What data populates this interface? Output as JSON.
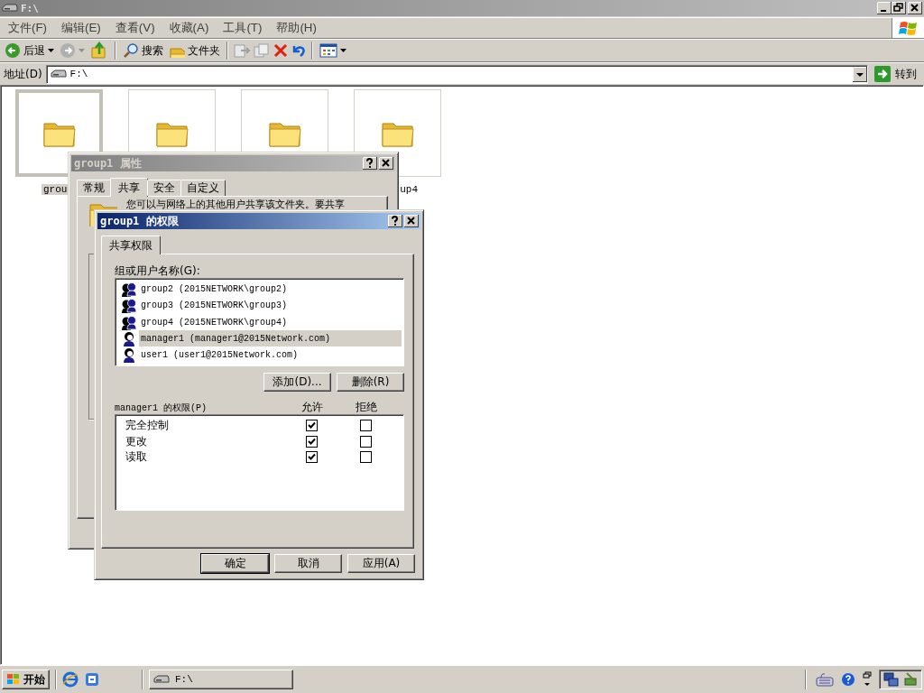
{
  "explorer": {
    "title": "F:\\",
    "menu": [
      "文件(F)",
      "编辑(E)",
      "查看(V)",
      "收藏(A)",
      "工具(T)",
      "帮助(H)"
    ],
    "toolbar": [
      {
        "kind": "back",
        "label": "后退"
      },
      {
        "kind": "forward"
      },
      {
        "kind": "up"
      },
      {
        "kind": "search",
        "label": "搜索"
      },
      {
        "kind": "folders",
        "label": "文件夹"
      },
      {
        "kind": "move"
      },
      {
        "kind": "copy"
      },
      {
        "kind": "delete"
      },
      {
        "kind": "undo"
      },
      {
        "kind": "views"
      }
    ],
    "address": {
      "label": "地址(D)",
      "value": "F:\\",
      "go": "转到"
    },
    "folders": [
      {
        "name": "grou",
        "selected": true
      },
      {
        "selected": false
      },
      {
        "selected": false
      },
      {
        "name": "up4",
        "selected": false
      }
    ]
  },
  "properties_dialog": {
    "title": "group1 属性",
    "tabs": [
      {
        "label": "常规",
        "selected": false
      },
      {
        "label": "共享",
        "selected": true
      },
      {
        "label": "安全",
        "selected": false
      },
      {
        "label": "自定义",
        "selected": false
      }
    ],
    "intro": "您可以与网络上的其他用户共享该文件夹。要共享"
  },
  "permissions_dialog": {
    "title": "group1 的权限",
    "tabs": [
      {
        "label": "共享权限",
        "selected": true
      }
    ],
    "list_label": "组或用户名称(G):",
    "principals": [
      {
        "kind": "group",
        "name": "group2 (2015NETWORK\\group2)",
        "selected": false
      },
      {
        "kind": "group",
        "name": "group3 (2015NETWORK\\group3)",
        "selected": false
      },
      {
        "kind": "group",
        "name": "group4 (2015NETWORK\\group4)",
        "selected": false
      },
      {
        "kind": "user",
        "name": "manager1 (manager1@2015Network.com)",
        "selected": true
      },
      {
        "kind": "user",
        "name": "user1 (user1@2015Network.com)",
        "selected": false
      }
    ],
    "list_buttons": [
      "添加(D)...",
      "删除(R)"
    ],
    "permissions_label": "manager1 的权限(P)",
    "columns": [
      "允许",
      "拒绝"
    ],
    "permissions": [
      {
        "name": "完全控制",
        "allow": true,
        "deny": false
      },
      {
        "name": "更改",
        "allow": true,
        "deny": false
      },
      {
        "name": "读取",
        "allow": true,
        "deny": false
      }
    ],
    "buttons": [
      "确定",
      "取消",
      "应用(A)"
    ]
  },
  "taskbar": {
    "start": "开始",
    "tasks": [
      {
        "label": "F:\\"
      }
    ]
  }
}
